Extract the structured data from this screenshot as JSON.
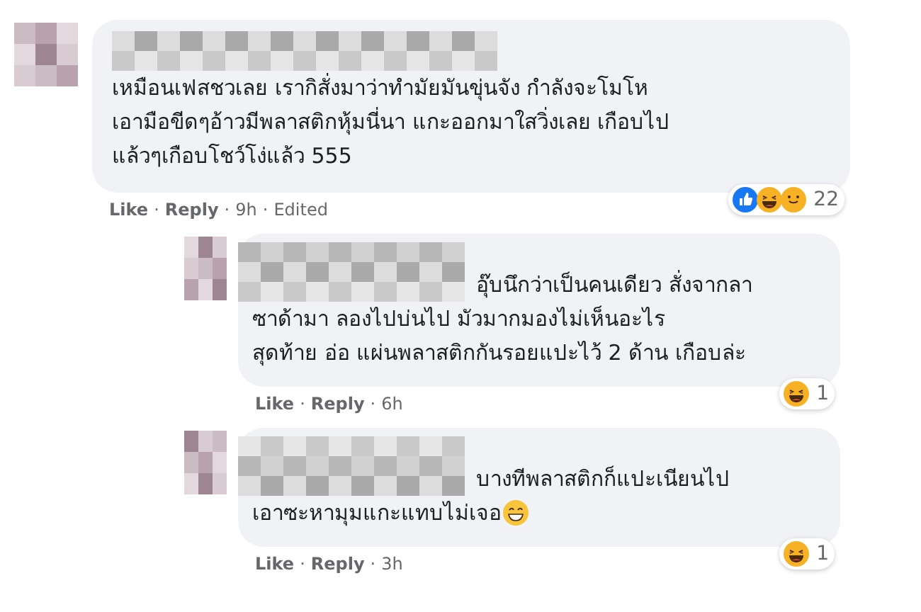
{
  "comments": [
    {
      "lines": [
        "เหมือนเฟสชวเลย เรากิสั่งมาว่าทำมัยมันขุ่นจัง กำลังจะโมโห",
        "เอามือขีดๆอ้าวมีพลาสติกหุ้มนี่นา แกะออกมาใสวิ่งเลย เกือบไป",
        "แล้วๆเกือบโชว์โง่แล้ว 555"
      ],
      "trailing_emoji": false,
      "actions": [
        "Like",
        "Reply"
      ],
      "separator": "·",
      "time": "9h",
      "edited": "Edited",
      "reactions": [
        {
          "kind": "like"
        },
        {
          "kind": "haha"
        },
        {
          "kind": "care"
        }
      ],
      "reaction_count": "22",
      "children": [
        {
          "lines": [
            "อุ๊บนึกว่าเป็นคนเดียว สั่งจากลา",
            "ซาด้ามา ลองไปบ่นไป มัวมากมองไม่เห็นอะไร",
            "สุดท้าย อ่อ แผ่นพลาสติกกันรอยแปะไว้ 2 ด้าน เกือบล่ะ"
          ],
          "trailing_emoji": false,
          "actions": [
            "Like",
            "Reply"
          ],
          "separator": "·",
          "time": "6h",
          "reactions": [
            {
              "kind": "haha"
            }
          ],
          "reaction_count": "1"
        },
        {
          "lines": [
            "บางทีพลาสติกก็แปะเนียนไป",
            "เอาซะหามุมแกะแทบไม่เจอ"
          ],
          "trailing_emoji": true,
          "actions": [
            "Like",
            "Reply"
          ],
          "separator": "·",
          "time": "3h",
          "reactions": [
            {
              "kind": "haha"
            }
          ],
          "reaction_count": "1"
        }
      ]
    }
  ]
}
